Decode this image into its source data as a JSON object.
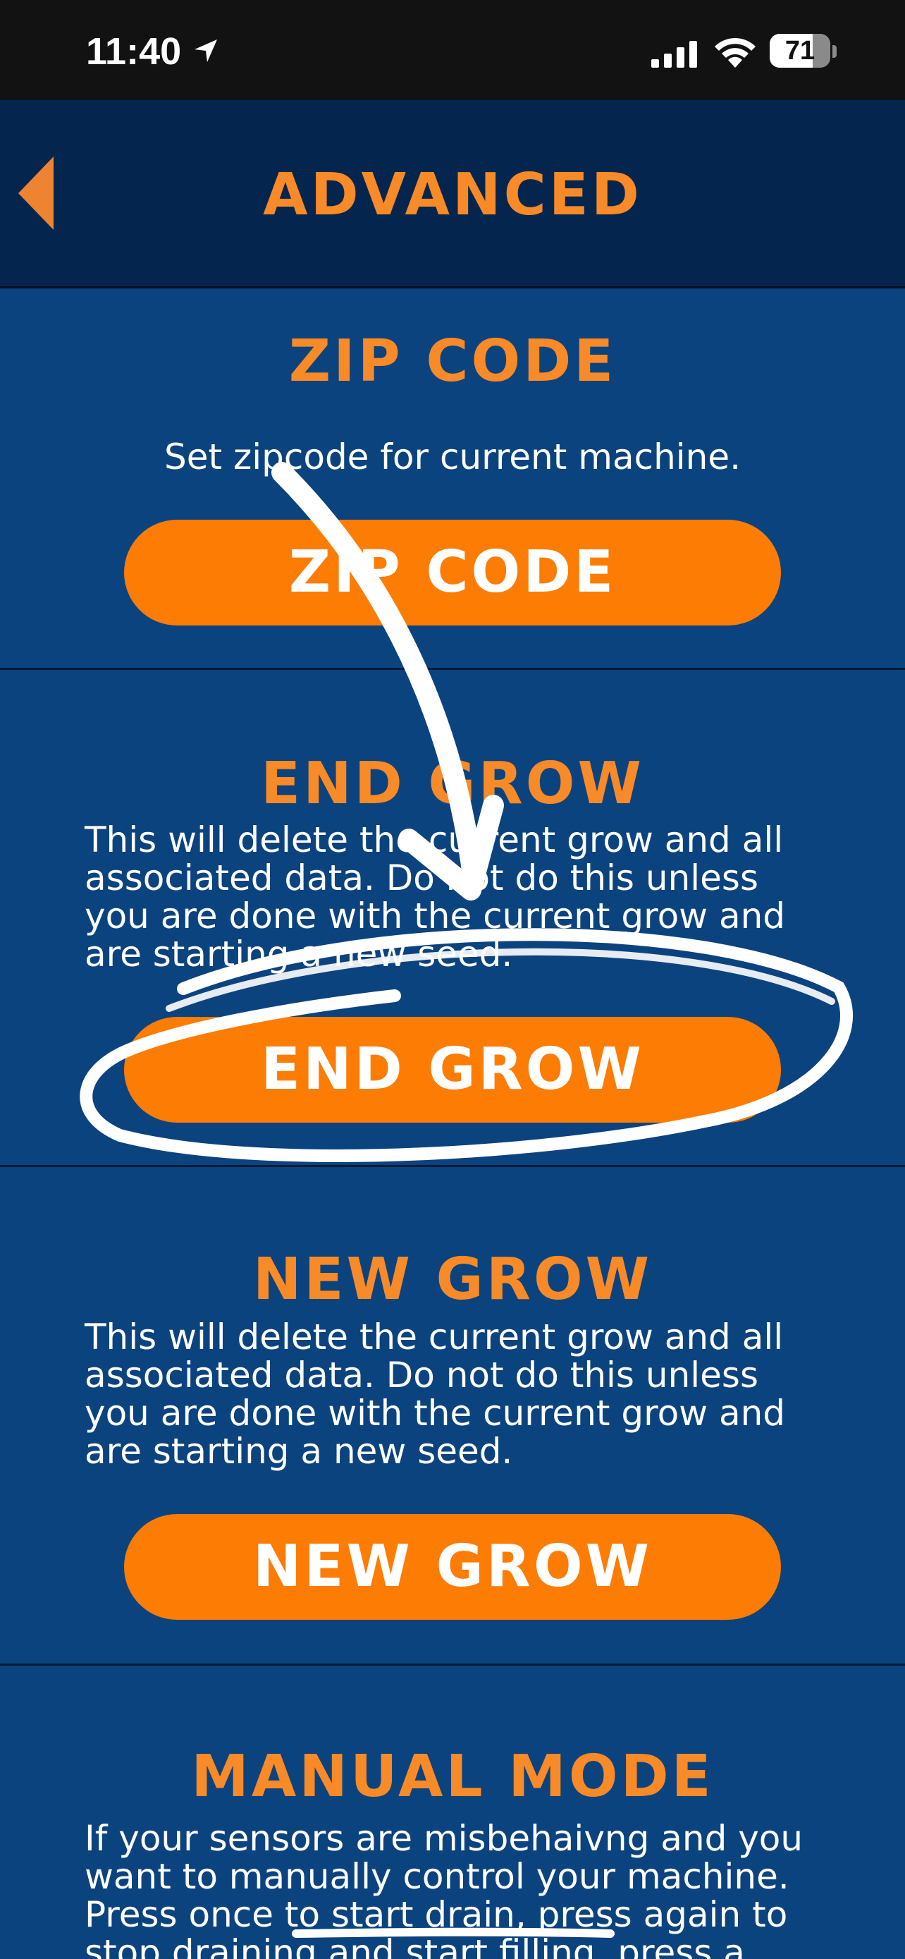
{
  "status_bar": {
    "time": "11:40",
    "battery_level": "71",
    "battery_fraction": 0.71,
    "icons": [
      "location-arrow-icon",
      "cellular-signal-icon",
      "wifi-icon",
      "battery-icon"
    ]
  },
  "header": {
    "title": "ADVANCED",
    "back_icon": "back-triangle-icon"
  },
  "sections": [
    {
      "title": "ZIP CODE",
      "description": "Set zipcode for current machine.",
      "button_label": "ZIP CODE"
    },
    {
      "title": "END GROW",
      "description": "This will delete the current grow and all associated data. Do not do this unless you are done with the current grow and are starting a new seed.",
      "button_label": "END GROW"
    },
    {
      "title": "NEW GROW",
      "description": "This will delete the current grow and all associated data. Do not do this unless you are done with the current grow and are starting a new seed.",
      "button_label": "NEW GROW"
    },
    {
      "title": "MANUAL MODE",
      "description": "If your sensors are misbehaivng and you want to manually control your machine. Press once to start drain, press again to stop draining and start filling, press a"
    }
  ],
  "colors": {
    "background": "#0b437f",
    "header_background": "#04264e",
    "accent_orange": "#f98a28",
    "button_orange": "#fd7c04",
    "annotation_white": "#ffffff"
  }
}
